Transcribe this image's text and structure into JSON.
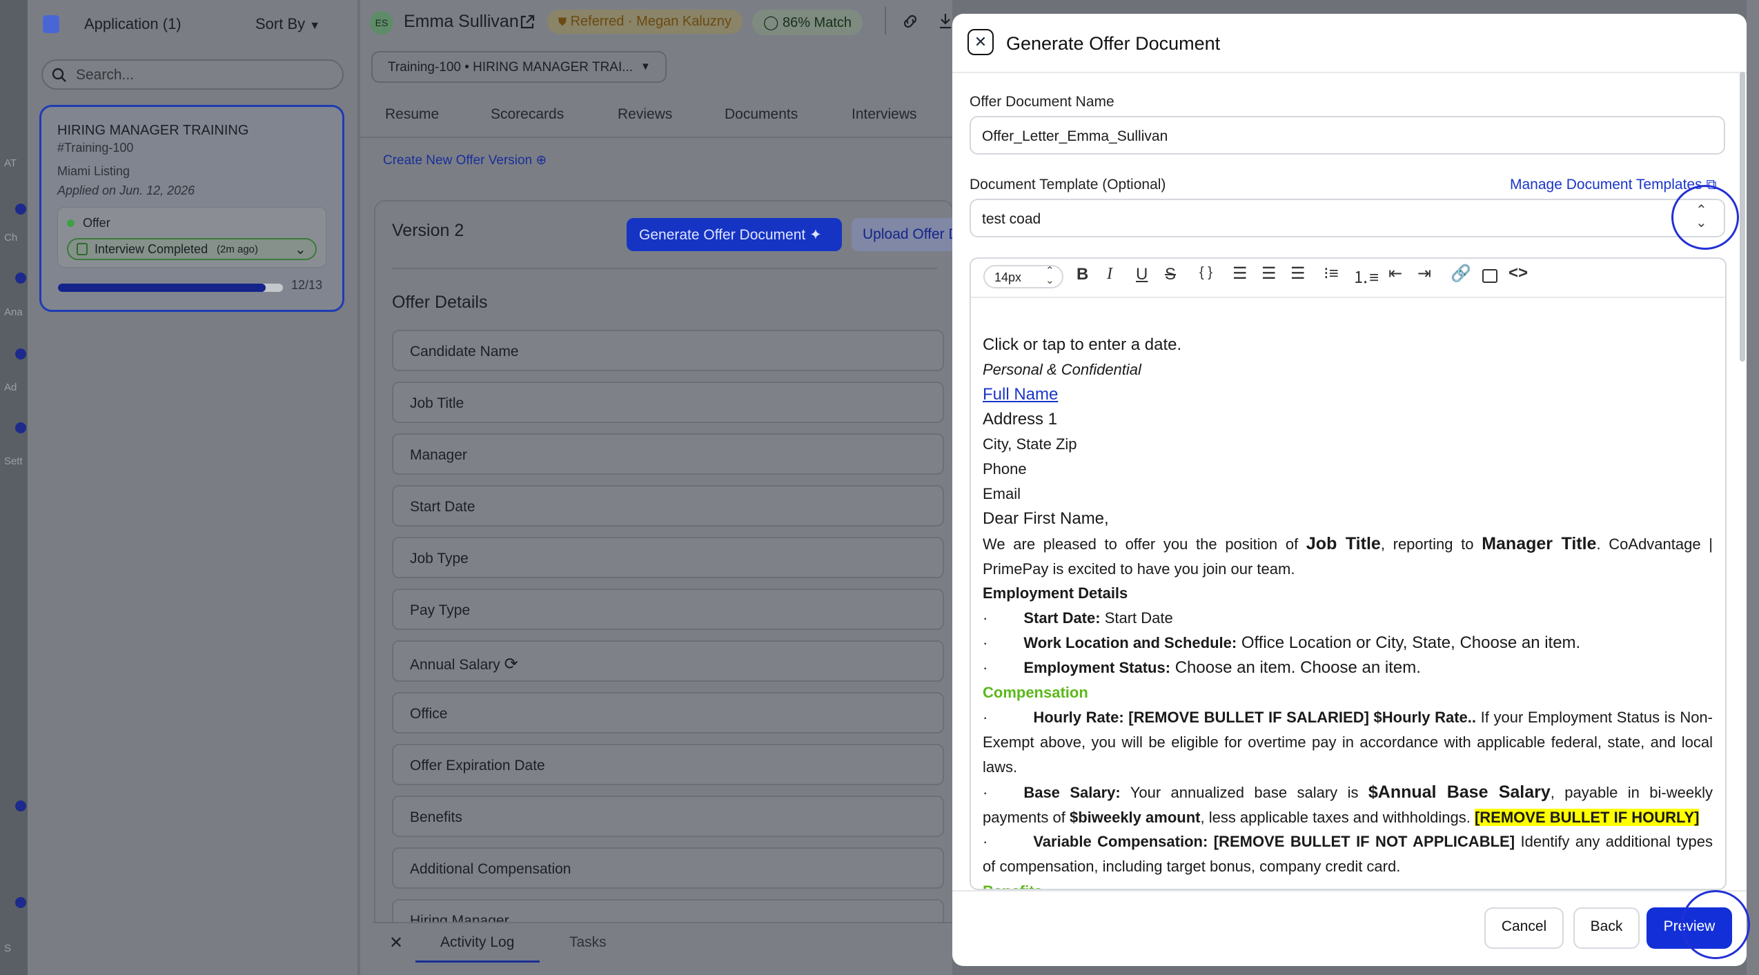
{
  "left_panel": {
    "title": "Application (1)",
    "sort_label": "Sort By",
    "search_placeholder": "Search...",
    "card": {
      "title": "HIRING MANAGER TRAINING",
      "code": "#Training-100",
      "location": "Miami Listing",
      "applied": "Applied on Jun. 12, 2026",
      "stage": "Offer",
      "status": "Interview Completed",
      "status_time": "(2m ago)",
      "progress_text": "12/13",
      "progress_fraction": 0.923
    },
    "strip_fragments": [
      "AT",
      "Ch",
      "Ana",
      "Ad",
      "Sett",
      "S"
    ]
  },
  "header": {
    "initials": "ES",
    "candidate_name": "Emma Sullivan",
    "referred": "Referred · Megan Kaluzny",
    "match": "86% Match",
    "template_select": "Training-100 • HIRING MANAGER TRAI..."
  },
  "tabs": [
    "Resume",
    "Scorecards",
    "Reviews",
    "Documents",
    "Interviews"
  ],
  "create_offer_link": "Create New Offer Version",
  "version_title": "Version 2",
  "generate_btn": "Generate Offer Document",
  "upload_btn": "Upload Offer D",
  "offer_details_title": "Offer Details",
  "offer_fields": [
    "Candidate Name",
    "Job Title",
    "Manager",
    "Start Date",
    "Job Type",
    "Pay Type",
    "Annual Salary",
    "Office",
    "Offer Expiration Date",
    "Benefits",
    "Additional Compensation",
    "Hiring Manager"
  ],
  "bottom_tabs": [
    "Activity Log",
    "Tasks"
  ],
  "modal": {
    "title": "Generate Offer Document",
    "doc_name_label": "Offer Document Name",
    "doc_name_value": "Offer_Letter_Emma_Sullivan",
    "template_label": "Document Template (Optional)",
    "manage_link": "Manage Document Templates",
    "template_value": "test coad",
    "font_size": "14px",
    "cancel": "Cancel",
    "back": "Back",
    "preview": "Preview"
  },
  "doc": {
    "l1": "Click or tap to enter a date.",
    "l2": "Personal & Confidential",
    "l3": "Full Name",
    "l4": "Address 1",
    "l5": "City, State Zip",
    "l6": "Phone",
    "l7": "Email",
    "l8": "Dear First Name,",
    "p1a": "We are pleased to offer you the position of ",
    "p1b": "Job Title",
    "p1c": ", reporting to ",
    "p1d": "Manager Title",
    "p1e": ". CoAdvantage | PrimePay is excited to have you join our team.",
    "emp_details": "Employment Details",
    "b1a": "Start Date:",
    "b1b": " Start Date",
    "b2a": "Work Location and Schedule:",
    "b2b": " Office Location or City, State, Choose an item.",
    "b3a": "Employment Status:",
    "b3b": " Choose an item. Choose an item.",
    "compensation": "Compensation",
    "h1a": "Hourly Rate: [REMOVE BULLET IF SALARIED] $Hourly Rate..",
    "h1b": " If your Employment Status is Non-Exempt above, you will be eligible for overtime pay in accordance with applicable federal, state, and local laws.",
    "s1a": "Base Salary:",
    "s1b": " Your annualized base salary is ",
    "s1c": "$Annual Base Salary",
    "s1d": ", payable in bi-weekly payments of ",
    "s1e": "$biweekly amount",
    "s1f": ", less applicable taxes and withholdings. ",
    "s1g": "[REMOVE BULLET IF HOURLY]",
    "v1a": "Variable Compensation: [REMOVE BULLET IF NOT APPLICABLE]",
    "v1b": " Identify any additional types of compensation, including target bonus, company credit card.",
    "benefits": "Benefits",
    "bullet": "·"
  }
}
